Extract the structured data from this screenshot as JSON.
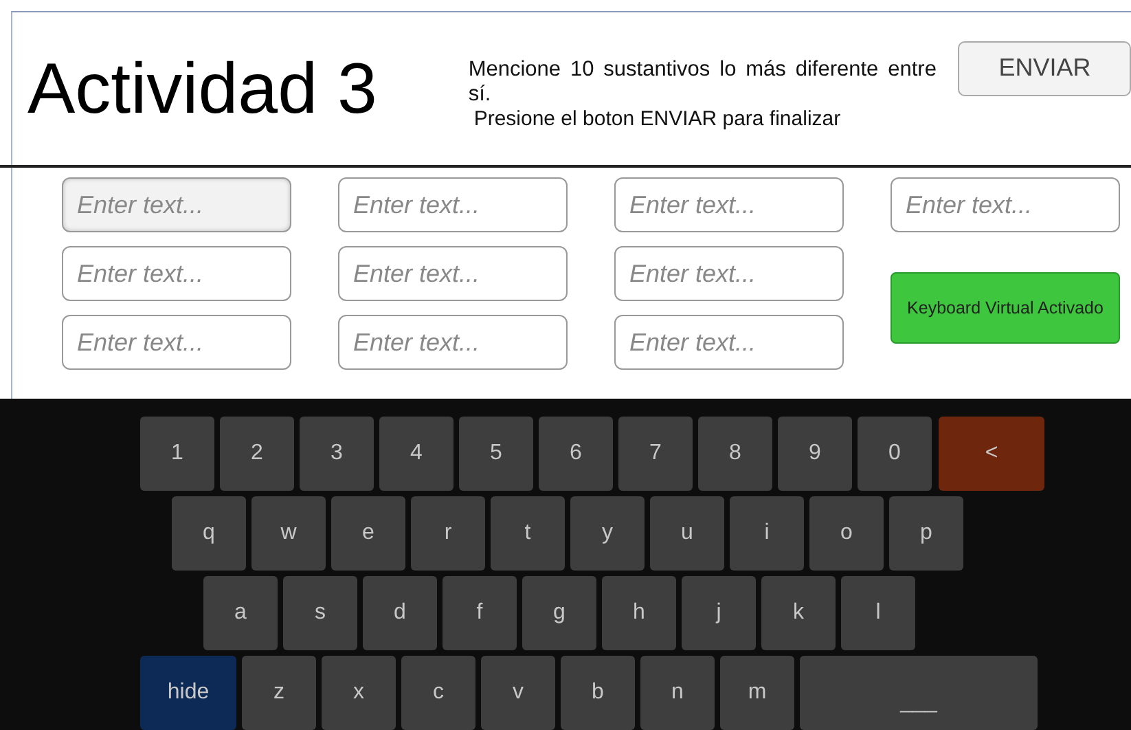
{
  "header": {
    "title": "Actividad 3",
    "instruction": "Mencione 10 sustantivos  lo más diferente entre sí.",
    "hint": "Presione el boton ENVIAR para finalizar",
    "submit_button": "ENVIAR"
  },
  "fields": [
    {
      "placeholder": "Enter text...",
      "focused": true
    },
    {
      "placeholder": "Enter text...",
      "focused": false
    },
    {
      "placeholder": "Enter text...",
      "focused": false
    },
    {
      "placeholder": "Enter text...",
      "focused": false
    },
    {
      "placeholder": "Enter text...",
      "focused": false
    },
    {
      "placeholder": "Enter text...",
      "focused": false
    },
    {
      "placeholder": "Enter text...",
      "focused": false
    },
    {
      "placeholder": "Enter text...",
      "focused": false
    },
    {
      "placeholder": "Enter text...",
      "focused": false
    },
    {
      "placeholder": "Enter text...",
      "focused": false
    }
  ],
  "keyboard_toggle": {
    "label": "Keyboard Virtual Activado",
    "on": true
  },
  "keyboard": {
    "rows": [
      {
        "keys": [
          {
            "label": "1",
            "kind": "char"
          },
          {
            "label": "2",
            "kind": "char"
          },
          {
            "label": "3",
            "kind": "char"
          },
          {
            "label": "4",
            "kind": "char"
          },
          {
            "label": "5",
            "kind": "char"
          },
          {
            "label": "6",
            "kind": "char"
          },
          {
            "label": "7",
            "kind": "char"
          },
          {
            "label": "8",
            "kind": "char"
          },
          {
            "label": "9",
            "kind": "char"
          },
          {
            "label": "0",
            "kind": "char"
          },
          {
            "label": "<",
            "kind": "backspace"
          }
        ]
      },
      {
        "keys": [
          {
            "label": "q",
            "kind": "char"
          },
          {
            "label": "w",
            "kind": "char"
          },
          {
            "label": "e",
            "kind": "char"
          },
          {
            "label": "r",
            "kind": "char"
          },
          {
            "label": "t",
            "kind": "char"
          },
          {
            "label": "y",
            "kind": "char"
          },
          {
            "label": "u",
            "kind": "char"
          },
          {
            "label": "i",
            "kind": "char"
          },
          {
            "label": "o",
            "kind": "char"
          },
          {
            "label": "p",
            "kind": "char"
          }
        ]
      },
      {
        "keys": [
          {
            "label": "a",
            "kind": "char"
          },
          {
            "label": "s",
            "kind": "char"
          },
          {
            "label": "d",
            "kind": "char"
          },
          {
            "label": "f",
            "kind": "char"
          },
          {
            "label": "g",
            "kind": "char"
          },
          {
            "label": "h",
            "kind": "char"
          },
          {
            "label": "j",
            "kind": "char"
          },
          {
            "label": "k",
            "kind": "char"
          },
          {
            "label": "l",
            "kind": "char"
          }
        ]
      },
      {
        "keys": [
          {
            "label": "hide",
            "kind": "hide"
          },
          {
            "label": "z",
            "kind": "char"
          },
          {
            "label": "x",
            "kind": "char"
          },
          {
            "label": "c",
            "kind": "char"
          },
          {
            "label": "v",
            "kind": "char"
          },
          {
            "label": "b",
            "kind": "char"
          },
          {
            "label": "n",
            "kind": "char"
          },
          {
            "label": "m",
            "kind": "char"
          },
          {
            "label": "___",
            "kind": "space"
          }
        ]
      }
    ]
  }
}
